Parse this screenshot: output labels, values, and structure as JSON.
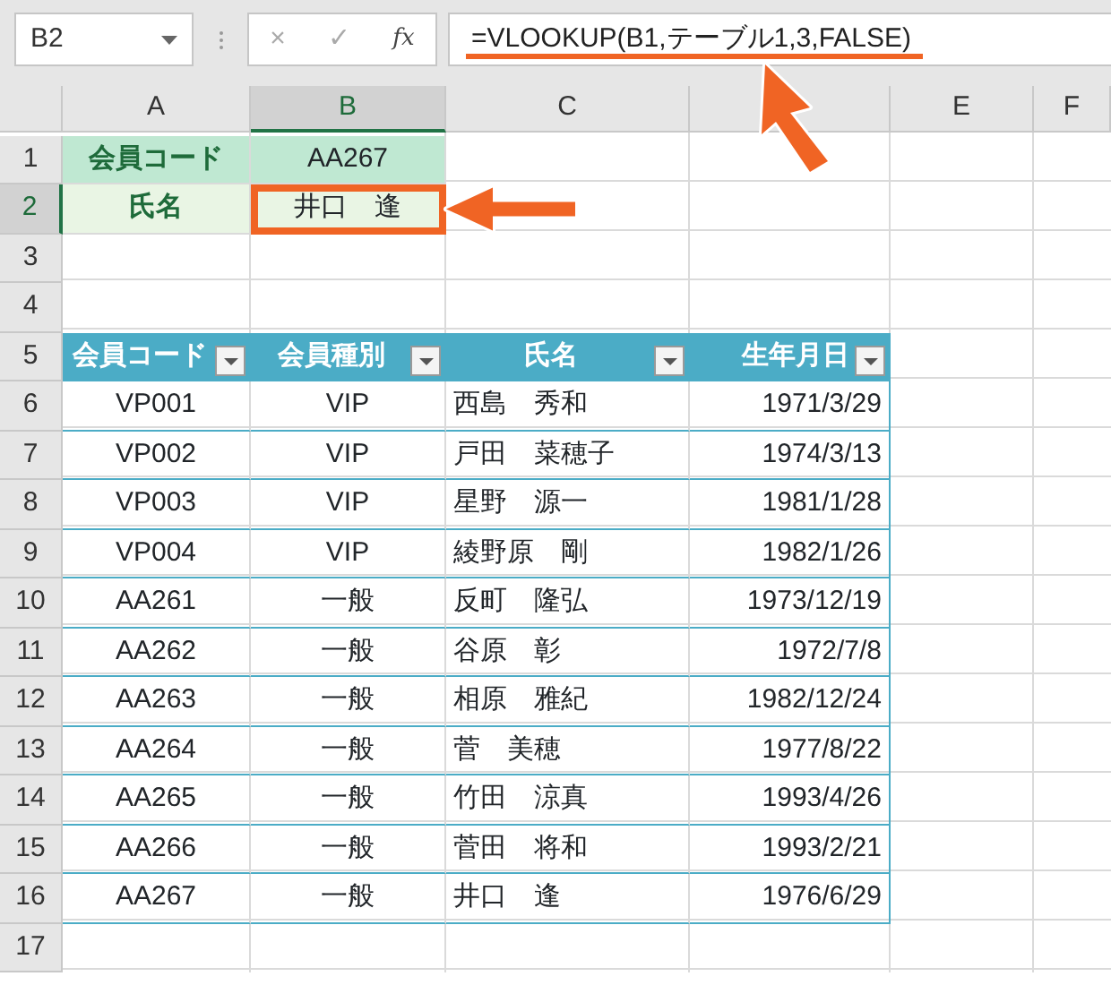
{
  "name_box": {
    "value": "B2"
  },
  "formula_bar": {
    "cancel": "×",
    "enter": "✓",
    "function_label": "fx",
    "formula": "=VLOOKUP(B1,テーブル1,3,FALSE)"
  },
  "columns": [
    {
      "label": "A",
      "selected": false
    },
    {
      "label": "B",
      "selected": true
    },
    {
      "label": "C",
      "selected": false
    },
    {
      "selected": false
    },
    {
      "label": "E",
      "selected": false
    },
    {
      "label": "F",
      "selected": false
    }
  ],
  "rows": [
    {
      "label": "1",
      "selected": false
    },
    {
      "label": "2",
      "selected": true
    },
    {
      "label": "3",
      "selected": false
    },
    {
      "label": "4",
      "selected": false
    },
    {
      "label": "5",
      "selected": false
    },
    {
      "label": "6",
      "selected": false
    },
    {
      "label": "7",
      "selected": false
    },
    {
      "label": "8",
      "selected": false
    },
    {
      "label": "9",
      "selected": false
    },
    {
      "label": "10",
      "selected": false
    },
    {
      "label": "11",
      "selected": false
    },
    {
      "label": "12",
      "selected": false
    },
    {
      "label": "13",
      "selected": false
    },
    {
      "label": "14",
      "selected": false
    },
    {
      "label": "15",
      "selected": false
    },
    {
      "label": "16",
      "selected": false
    },
    {
      "label": "17",
      "selected": false
    }
  ],
  "lookup": [
    {
      "label": "会員コード",
      "value": "AA267",
      "selected": false
    },
    {
      "label": "氏名",
      "value": "井口　逢",
      "selected": true
    }
  ],
  "table": {
    "columns": [
      {
        "label": "会員コード"
      },
      {
        "label": "会員種別"
      },
      {
        "label": "氏名"
      },
      {
        "label": "生年月日"
      }
    ],
    "rows": [
      [
        "VP001",
        "VIP",
        "西島　秀和",
        "1971/3/29"
      ],
      [
        "VP002",
        "VIP",
        "戸田　菜穂子",
        "1974/3/13"
      ],
      [
        "VP003",
        "VIP",
        "星野　源一",
        "1981/1/28"
      ],
      [
        "VP004",
        "VIP",
        "綾野原　剛",
        "1982/1/26"
      ],
      [
        "AA261",
        "一般",
        "反町　隆弘",
        "1973/12/19"
      ],
      [
        "AA262",
        "一般",
        "谷原　彰",
        "1972/7/8"
      ],
      [
        "AA263",
        "一般",
        "相原　雅紀",
        "1982/12/24"
      ],
      [
        "AA264",
        "一般",
        "菅　美穂",
        "1977/8/22"
      ],
      [
        "AA265",
        "一般",
        "竹田　涼真",
        "1993/4/26"
      ],
      [
        "AA266",
        "一般",
        "菅田　将和",
        "1993/2/21"
      ],
      [
        "AA267",
        "一般",
        "井口　逢",
        "1976/6/29"
      ]
    ]
  },
  "annotations": [
    {
      "kind": "underline"
    },
    {
      "kind": "pointer"
    },
    {
      "kind": "arrow"
    }
  ]
}
